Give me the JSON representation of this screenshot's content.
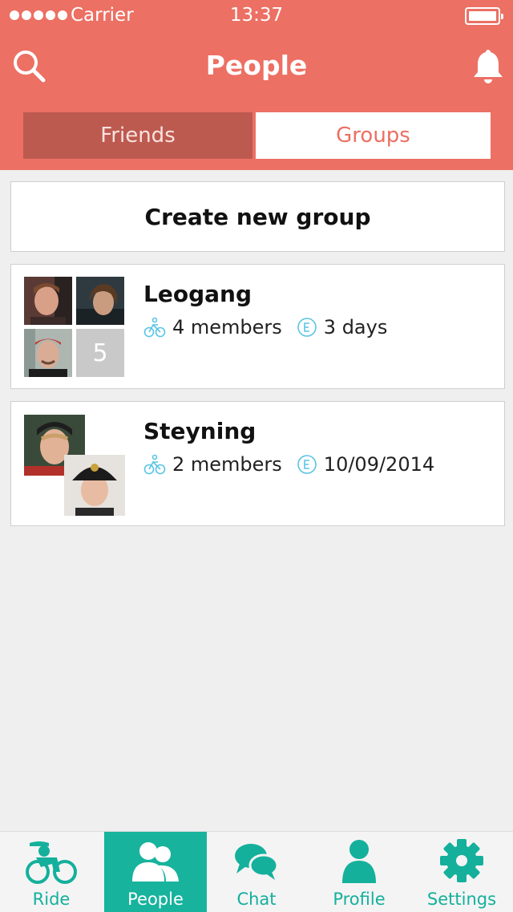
{
  "status_bar": {
    "carrier": "Carrier",
    "time": "13:37"
  },
  "header": {
    "title": "People",
    "left_icon": "search-icon",
    "right_icon": "bell-icon"
  },
  "segments": [
    {
      "label": "Friends",
      "selected": false
    },
    {
      "label": "Groups",
      "selected": true
    }
  ],
  "create_group": {
    "label": "Create new group"
  },
  "groups": [
    {
      "name": "Leogang",
      "members": "4 members",
      "info": "3 days",
      "extra_count": "5"
    },
    {
      "name": "Steyning",
      "members": "2 members",
      "info": "10/09/2014"
    }
  ],
  "tab_bar": [
    {
      "label": "Ride",
      "icon": "bike-rider-icon",
      "active": false
    },
    {
      "label": "People",
      "icon": "people-icon",
      "active": true
    },
    {
      "label": "Chat",
      "icon": "chat-bubbles-icon",
      "active": false
    },
    {
      "label": "Profile",
      "icon": "person-icon",
      "active": false
    },
    {
      "label": "Settings",
      "icon": "gear-icon",
      "active": false
    }
  ],
  "colors": {
    "header": "#ec7063",
    "selected_segment": "#bd5a50",
    "accent": "#17b39d",
    "background": "#efefef"
  }
}
